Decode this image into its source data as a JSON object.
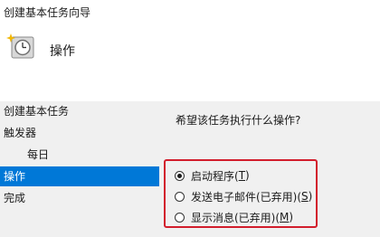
{
  "window": {
    "title": "创建基本任务向导"
  },
  "header": {
    "icon": "clock-sparkle-icon",
    "label": "操作"
  },
  "sidebar": {
    "items": [
      {
        "label": "创建基本任务"
      },
      {
        "label": "触发器"
      },
      {
        "label": "每日"
      },
      {
        "label": "操作",
        "selected": true
      },
      {
        "label": "完成"
      }
    ]
  },
  "main": {
    "question": "希望该任务执行什么操作?",
    "options": [
      {
        "text": "启动程序(",
        "key": "T",
        "suffix": ")",
        "checked": true
      },
      {
        "text": "发送电子邮件(已弃用)(",
        "key": "S",
        "suffix": ")",
        "checked": false
      },
      {
        "text": "显示消息(已弃用)(",
        "key": "M",
        "suffix": ")",
        "checked": false
      }
    ]
  },
  "colors": {
    "selection": "#0078d7",
    "highlight_border": "#d21d2c",
    "panel_bg": "#f0f0f0"
  }
}
